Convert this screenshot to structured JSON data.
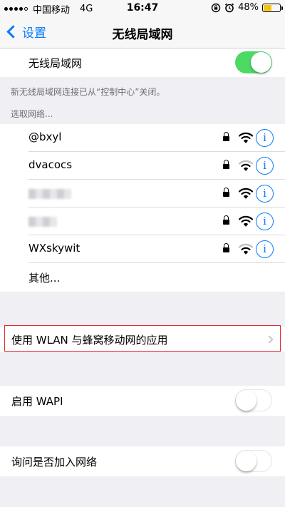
{
  "status_bar": {
    "carrier": "中国移动",
    "network": "4G",
    "time": "16:47",
    "battery": "48%",
    "battery_level": 0.48,
    "battery_color": "#f5c400"
  },
  "nav": {
    "back_label": "设置",
    "title": "无线局域网"
  },
  "wlan": {
    "label": "无线局域网",
    "enabled": true,
    "toggle_color": "#4cd964"
  },
  "note": "新无线局域网连接已从“控制中心”关闭。",
  "choose_label": "选取网络...",
  "networks": [
    {
      "name": "@bxyl",
      "locked": true,
      "signal": "full"
    },
    {
      "name": "dvacocs",
      "locked": true,
      "signal": "medium"
    },
    {
      "name": "",
      "locked": true,
      "signal": "full"
    },
    {
      "name": "",
      "locked": true,
      "signal": "full"
    },
    {
      "name": "WXskywit",
      "locked": true,
      "signal": "medium"
    }
  ],
  "other_label": "其他...",
  "apps_row": {
    "label": "使用 WLAN 与蜂窝移动网的应用"
  },
  "wapi": {
    "label": "启用 WAPI",
    "enabled": false
  },
  "ask_join": {
    "label": "询问是否加入网络",
    "enabled": false
  },
  "accent_color": "#0a7aff",
  "highlight_color": "#e3282f"
}
